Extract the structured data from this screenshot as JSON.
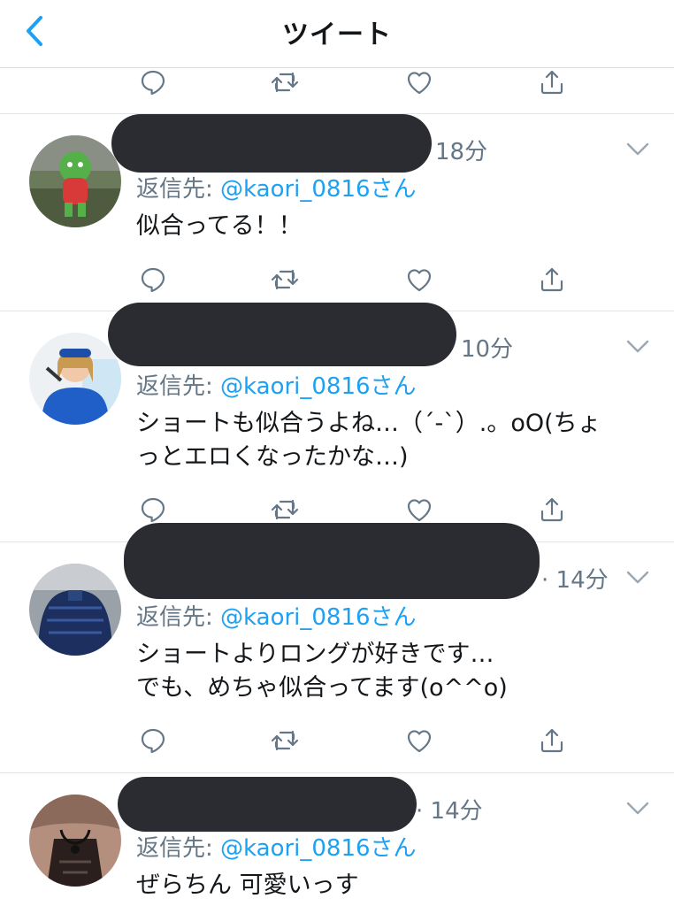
{
  "nav": {
    "title": "ツイート"
  },
  "tweets": [
    {
      "time": "18分",
      "reply_label": "返信先:",
      "reply_handle": "@kaori_0816さん",
      "text": "似合ってる！！"
    },
    {
      "time": "10分",
      "reply_label": "返信先:",
      "reply_handle": "@kaori_0816さん",
      "text_lines": [
        "ショートも似合うよね…（´-`）.。oO(ちょ",
        "っとエロくなったかな…)"
      ]
    },
    {
      "time": "· 14分",
      "reply_label": "返信先:",
      "reply_handle": "@kaori_0816さん",
      "text_lines": [
        "ショートよりロングが好きです…",
        "でも、めちゃ似合ってます(o^^o)"
      ]
    },
    {
      "time": "· 14分",
      "reply_label": "返信先:",
      "reply_handle": "@kaori_0816さん",
      "text": "ぜらちん 可愛いっす"
    }
  ],
  "icons": [
    "back-chevron-icon",
    "reply-icon",
    "retweet-icon",
    "like-icon",
    "share-icon",
    "caret-down-icon"
  ],
  "colors": {
    "link": "#1da1f2",
    "meta": "#657786",
    "text": "#14171a",
    "redaction": "#2a2c31",
    "icon": "#657786"
  }
}
